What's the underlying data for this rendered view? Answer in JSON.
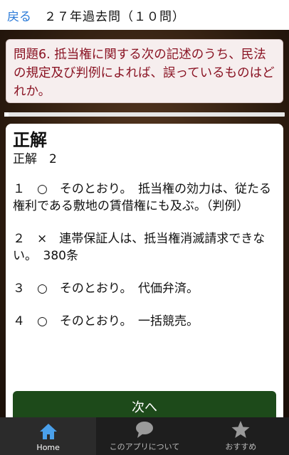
{
  "header": {
    "back_label": "戻る",
    "title": "２７年過去問（１０問）"
  },
  "question": {
    "text": "問題6. 抵当権に関する次の記述のうち、民法の規定及び判例によれば、誤っているものはどれか。"
  },
  "answer": {
    "heading": "正解",
    "correct": "正解　2",
    "lines": [
      "１　○　そのとおり。　抵当権の効力は、従たる権利である敷地の賃借権にも及ぶ。（判例）",
      "２　×　連帯保証人は、抵当権消滅請求できない。　380条",
      "３　○　そのとおり。　代価弁済。",
      "４　○　そのとおり。　一括競売。"
    ]
  },
  "next_button": "次へ",
  "nav": {
    "items": [
      {
        "label": "Home",
        "icon": "home-icon"
      },
      {
        "label": "このアプリについて",
        "icon": "speech-bubble-icon"
      },
      {
        "label": "おすすめ",
        "icon": "star-icon"
      }
    ]
  }
}
